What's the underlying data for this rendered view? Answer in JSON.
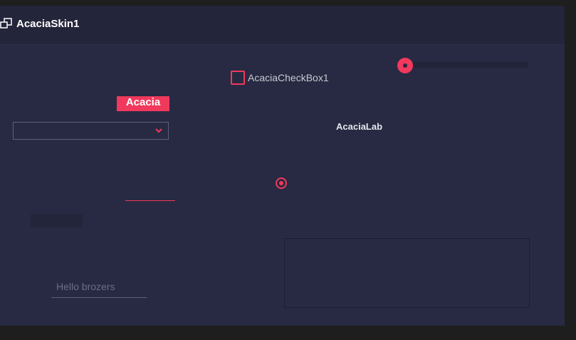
{
  "window": {
    "title": "AcaciaSkin1",
    "title_icon": "windows-icon"
  },
  "slider": {
    "value_fraction": 0.0
  },
  "checkbox": {
    "label": "AcaciaCheckBox1",
    "checked": false
  },
  "badge": {
    "label": "Acacia"
  },
  "combo": {
    "selected": ""
  },
  "lab": {
    "label": "AcaciaLab"
  },
  "radio": {
    "checked": true
  },
  "textbox": {
    "placeholder": "Hello brozers"
  },
  "colors": {
    "accent": "#f0395c",
    "background": "#272a42",
    "titlebar": "#23253a"
  }
}
